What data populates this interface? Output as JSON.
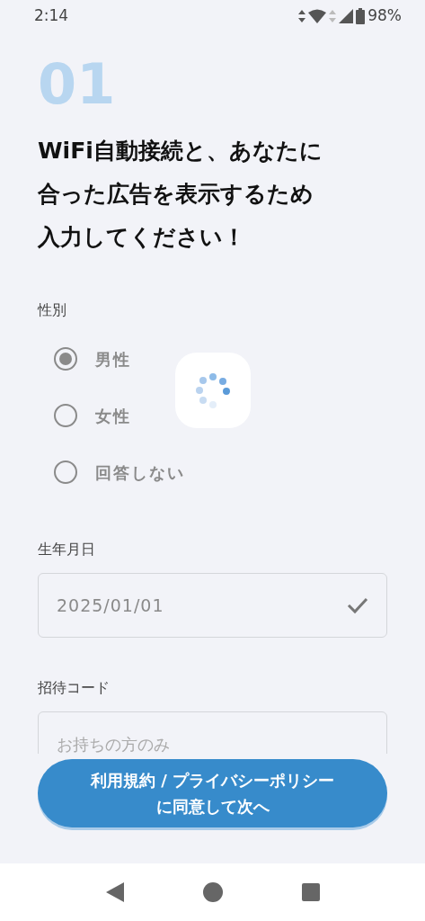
{
  "status_bar": {
    "time": "2:14",
    "battery": "98%"
  },
  "step": "01",
  "heading_lines": [
    "WiFi自動接続と、あなたに",
    "合った広告を表示するため",
    "入力してください！"
  ],
  "gender": {
    "label": "性別",
    "options": [
      {
        "label": "男性",
        "selected": true
      },
      {
        "label": "女性",
        "selected": false
      },
      {
        "label": "回答しない",
        "selected": false
      }
    ]
  },
  "loading": true,
  "birthdate": {
    "label": "生年月日",
    "value": "2025/01/01",
    "valid": true
  },
  "invite_code": {
    "label": "招待コード",
    "placeholder": "お持ちの方のみ"
  },
  "submit_button_lines": [
    "利用規約 / プライバシーポリシー",
    "に同意して次へ"
  ]
}
